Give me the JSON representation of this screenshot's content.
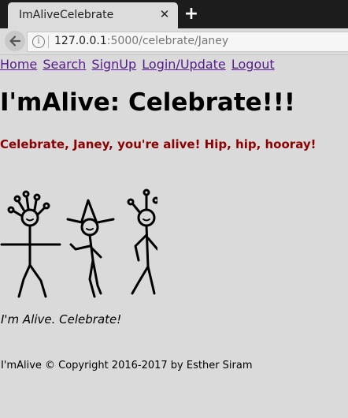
{
  "browser": {
    "tab_title": "ImAliveCelebrate",
    "close_glyph": "✕",
    "new_tab_glyph": "+",
    "info_glyph": "i",
    "url_host": "127.0.0.1",
    "url_rest": ":5000/celebrate/Janey"
  },
  "nav": {
    "home": "Home",
    "search": "Search",
    "signup": "SignUp",
    "login_update": "Login/Update",
    "logout": "Logout"
  },
  "main": {
    "heading": "I'mAlive: Celebrate!!!",
    "subheading": "Celebrate, Janey, you're alive! Hip, hip, hooray!",
    "image_caption": "I'm Alive. Celebrate!"
  },
  "footer": {
    "copyright": "I'mAlive © Copyright 2016-2017 by Esther Siram"
  },
  "colors": {
    "page_bg": "#dadada",
    "link": "#551a8b",
    "subheading": "#8b0000",
    "tabstrip": "#1c1c1c"
  }
}
